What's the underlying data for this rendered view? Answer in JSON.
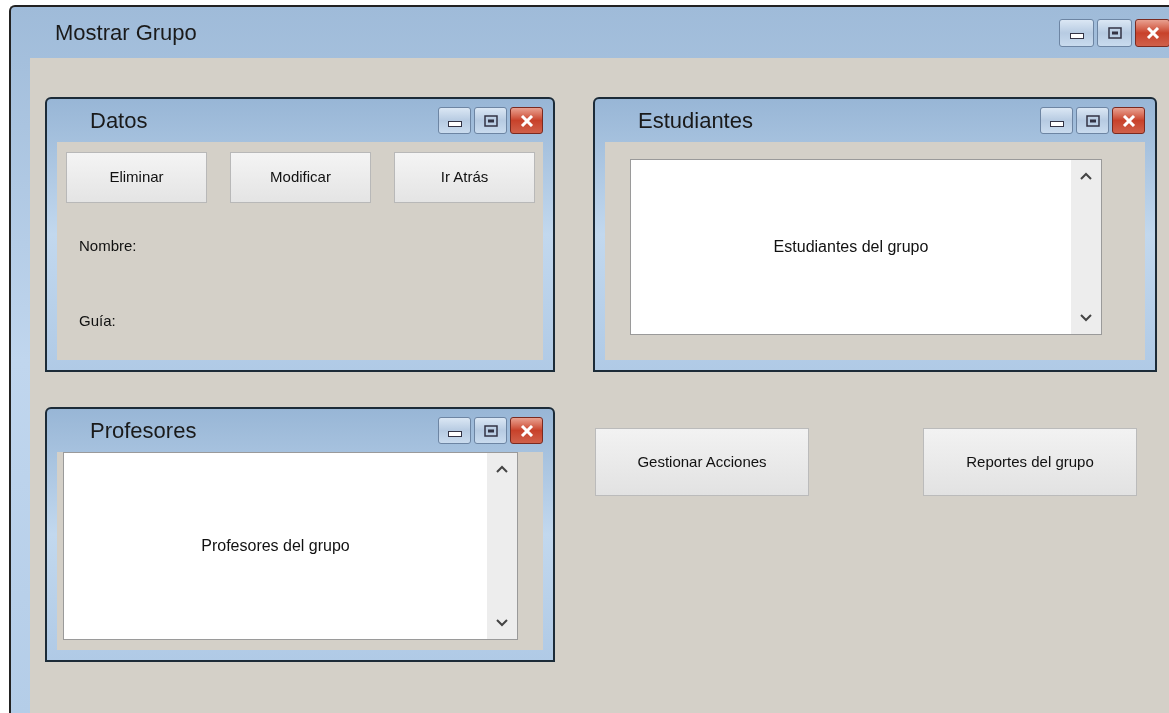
{
  "window": {
    "title": "Mostrar Grupo"
  },
  "panels": [
    {
      "kind": "form",
      "title": "Datos",
      "buttons": [
        "Eliminar",
        "Modificar",
        "Ir Atrás"
      ],
      "fields": [
        "Nombre:",
        "Guía:"
      ]
    },
    {
      "kind": "list",
      "title": "Estudiantes",
      "list_text": "Estudiantes del grupo"
    },
    {
      "kind": "list",
      "title": "Profesores",
      "list_text": "Profesores del grupo"
    }
  ],
  "actions": [
    "Gestionar Acciones",
    "Reportes del grupo"
  ]
}
